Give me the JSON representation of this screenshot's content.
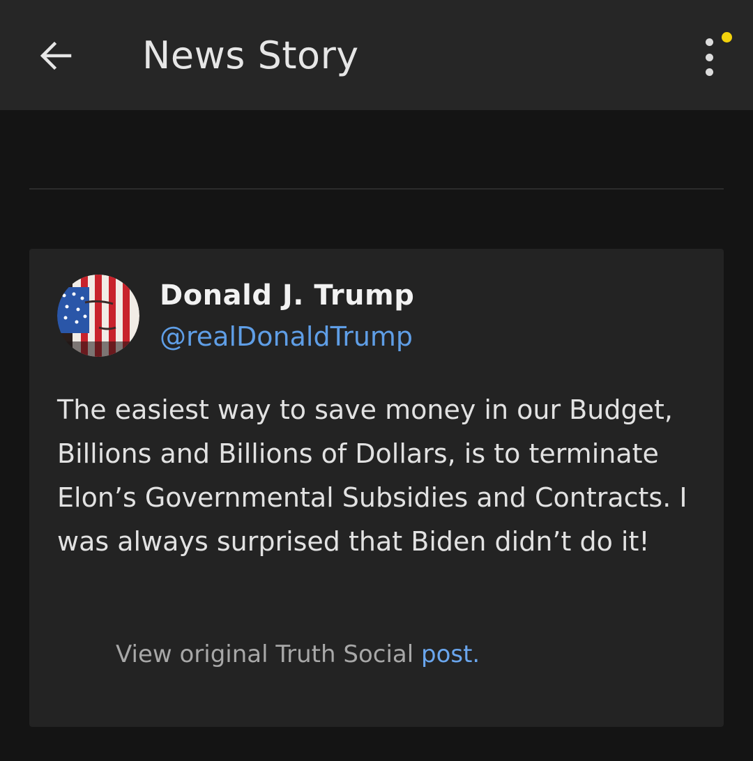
{
  "header": {
    "title": "News Story",
    "back_icon": "arrow-left-icon",
    "menu_icon": "more-vertical-icon",
    "notification_dot_color": "#f2d20c"
  },
  "post": {
    "author_name": "Donald J. Trump",
    "author_handle": "@realDonaldTrump",
    "avatar_icon": "avatar-flag-portrait",
    "text": "The easiest way to save money in our Budget, Billions and Billions of Dollars, is to terminate Elon’s Governmental Subsidies and Contracts. I was always surprised that Biden didn’t do it!",
    "source_prefix": "View original Truth Social",
    "source_link_text": "post."
  },
  "colors": {
    "background": "#141414",
    "app_bar": "#262626",
    "card": "#232323",
    "link": "#5f9ee6"
  }
}
